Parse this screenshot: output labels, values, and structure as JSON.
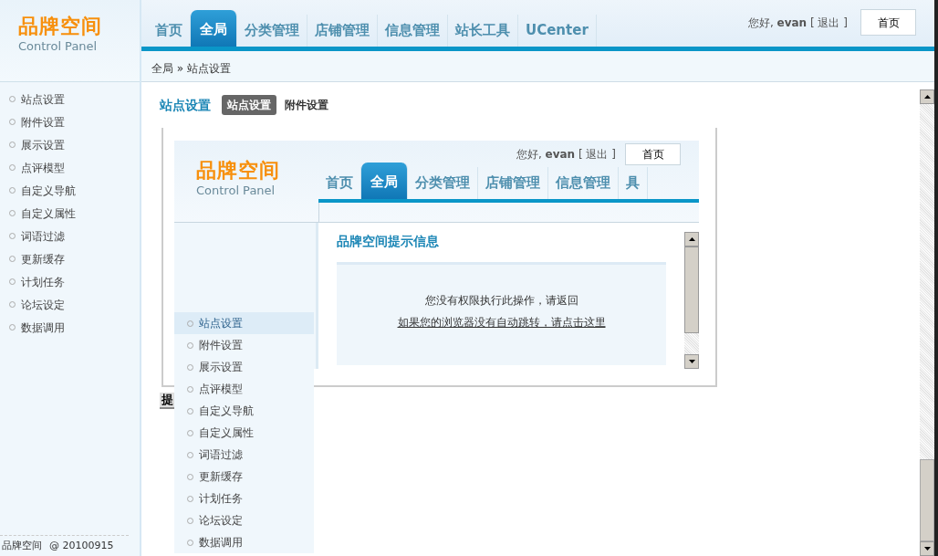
{
  "header": {
    "logo_title": "品牌空间",
    "logo_subtitle": "Control Panel",
    "nav": [
      {
        "label": "首页",
        "selected": false
      },
      {
        "label": "全局",
        "selected": true
      },
      {
        "label": "分类管理",
        "selected": false
      },
      {
        "label": "店铺管理",
        "selected": false
      },
      {
        "label": "信息管理",
        "selected": false
      },
      {
        "label": "站长工具",
        "selected": false
      },
      {
        "label": "UCenter",
        "selected": false
      }
    ],
    "greeting": "您好,",
    "username": "evan",
    "logout": "[ 退出 ]",
    "home_button": "首页"
  },
  "sidebar": {
    "items": [
      "站点设置",
      "附件设置",
      "展示设置",
      "点评模型",
      "自定义导航",
      "自定义属性",
      "词语过滤",
      "更新缓存",
      "计划任务",
      "论坛设定",
      "数据调用"
    ],
    "footer_brand": "品牌空间",
    "footer_version": "@ 20100915"
  },
  "breadcrumb": "全局 » 站点设置",
  "page": {
    "title": "站点设置",
    "subtabs": [
      {
        "label": "站点设置",
        "selected": true
      },
      {
        "label": "附件设置",
        "selected": false
      }
    ],
    "frame": {
      "header": {
        "logo_title": "品牌空间",
        "logo_subtitle": "Control Panel",
        "nav": [
          {
            "label": "首页",
            "selected": false
          },
          {
            "label": "全局",
            "selected": true
          },
          {
            "label": "分类管理",
            "selected": false
          },
          {
            "label": "店铺管理",
            "selected": false
          },
          {
            "label": "信息管理",
            "selected": false
          },
          {
            "label": "具",
            "selected": false
          }
        ],
        "greeting": "您好,",
        "username": "evan",
        "logout": "[ 退出 ]",
        "home_button": "首页"
      },
      "sidebar_items": [
        {
          "label": "站点设置",
          "selected": true
        },
        {
          "label": "附件设置",
          "selected": false
        },
        {
          "label": "展示设置",
          "selected": false
        },
        {
          "label": "点评模型",
          "selected": false
        },
        {
          "label": "自定义导航",
          "selected": false
        },
        {
          "label": "自定义属性",
          "selected": false
        },
        {
          "label": "词语过滤",
          "selected": false
        },
        {
          "label": "更新缓存",
          "selected": false
        },
        {
          "label": "计划任务",
          "selected": false
        },
        {
          "label": "论坛设定",
          "selected": false
        },
        {
          "label": "数据调用",
          "selected": false
        }
      ],
      "message_title": "品牌空间提示信息",
      "message": "您没有权限执行此操作，请返回",
      "link": "如果您的浏览器没有自动跳转，请点击这里"
    },
    "partial_button": "提"
  }
}
